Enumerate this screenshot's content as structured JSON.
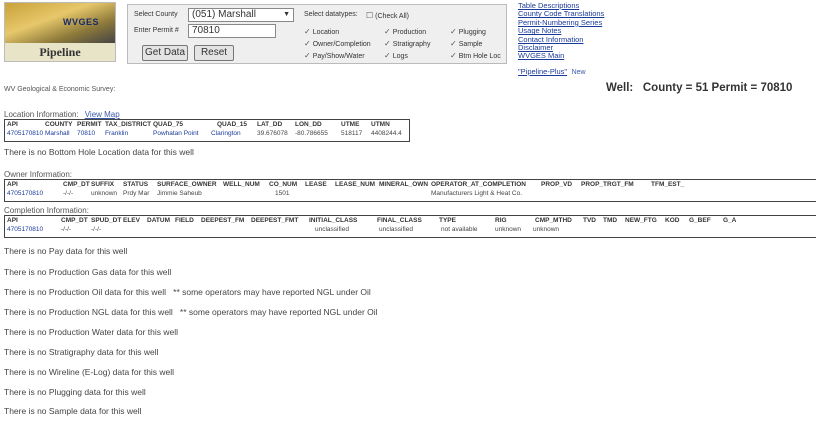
{
  "header": {
    "app_title": "Pipeline",
    "logo_text": "WVGES",
    "select_county_label": "Select County",
    "county_value": "(051) Marshall",
    "permit_label": "Enter Permit #",
    "permit_value": "70810",
    "get_data_label": "Get Data",
    "reset_label": "Reset",
    "datatypes_label": "Select datatypes:",
    "check_all_label": "(Check All)",
    "checks": [
      {
        "label": "Location"
      },
      {
        "label": "Owner/Completion"
      },
      {
        "label": "Pay/Show/Water"
      },
      {
        "label": "Production"
      },
      {
        "label": "Stratigraphy"
      },
      {
        "label": "Logs"
      },
      {
        "label": "Plugging"
      },
      {
        "label": "Sample"
      },
      {
        "label": "Btm Hole Loc"
      }
    ],
    "links": [
      "Table Descriptions",
      "County Code Translations",
      "Permit-Numbering Series",
      "Usage Notes",
      "Contact Information",
      "Disclaimer",
      "WVGES Main",
      "\"Pipeline-Plus\""
    ],
    "new_label": "New"
  },
  "subheader": {
    "org": "WV Geological & Economic Survey:",
    "well_label": "Well:",
    "well_text": "County = 51 Permit = 70810"
  },
  "location": {
    "title": "Location Information:",
    "view_map": "View Map",
    "columns": [
      "API",
      "COUNTY",
      "PERMIT",
      "TAX_DISTRICT",
      "QUAD_75",
      "QUAD_15",
      "LAT_DD",
      "LON_DD",
      "UTME",
      "UTMN"
    ],
    "row": [
      "4705170810",
      "Marshall",
      "70810",
      "Franklin",
      "Powhatan Point",
      "Clarington",
      "39.676078",
      "-80.786655",
      "518117",
      "4408244.4"
    ]
  },
  "bottom_hole_msg": "There is no Bottom Hole Location data for this well",
  "owner": {
    "title": "Owner Information:",
    "columns": [
      "API",
      "CMP_DT",
      "SUFFIX",
      "STATUS",
      "SURFACE_OWNER",
      "WELL_NUM",
      "CO_NUM",
      "LEASE",
      "LEASE_NUM",
      "MINERAL_OWN",
      "OPERATOR_AT_COMPLETION",
      "PROP_VD",
      "PROP_TRGT_FM",
      "TFM_EST_"
    ],
    "row": [
      "4705170810",
      "-/-/-",
      "unknown",
      "Prdy Mar",
      "Jimmie Saheub",
      "",
      "1501",
      "",
      "",
      "",
      "Manufacturers Light & Heat Co.",
      "",
      "",
      ""
    ]
  },
  "completion": {
    "title": "Completion Information:",
    "columns": [
      "API",
      "CMP_DT",
      "SPUD_DT",
      "ELEV",
      "DATUM",
      "FIELD",
      "DEEPEST_FM",
      "DEEPEST_FMT",
      "INITIAL_CLASS",
      "FINAL_CLASS",
      "TYPE",
      "RIG",
      "CMP_MTHD",
      "TVD",
      "TMD",
      "NEW_FTG",
      "KOD",
      "G_BEF",
      "G_A"
    ],
    "row": [
      "4705170810",
      "-/-/-",
      "-/-/-",
      "",
      "",
      "",
      "",
      "",
      "unclassified",
      "unclassified",
      "not available",
      "unknown",
      "unknown",
      "",
      "",
      "",
      "",
      "",
      ""
    ]
  },
  "messages": [
    "There is no Pay data for this well",
    "There is no Production Gas data for this well",
    "There is no Production Oil data for this well   ** some operators may have reported NGL under Oil",
    "There is no Production NGL data for this well   ** some operators may have reported NGL under Oil",
    "There is no Production Water data for this well",
    "There is no Stratigraphy data for this well",
    "There is no Wireline (E-Log) data for this well",
    "There is no Plugging data for this well",
    "There is no Sample data for this well"
  ],
  "colors": {
    "link": "#1a3a9a",
    "panel_bg": "#efefef"
  }
}
